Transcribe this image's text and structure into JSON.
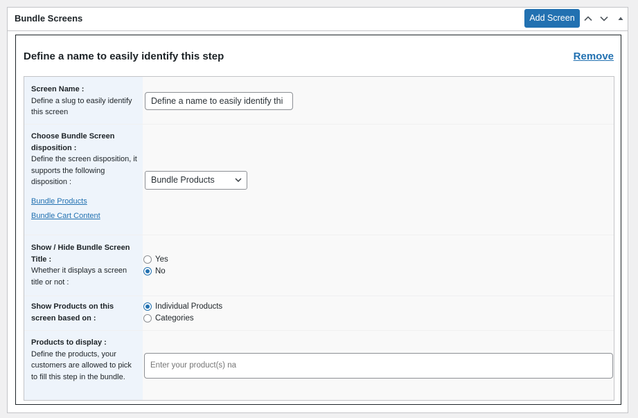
{
  "postbox": {
    "title": "Bundle Screens",
    "add_button": "Add Screen"
  },
  "step": {
    "title": "Define a name to easily identify this step",
    "remove_label": "Remove"
  },
  "fields": {
    "screen_name": {
      "label": "Screen Name :",
      "description": "Define a slug to easily identify this screen",
      "value": "Define a name to easily identify thi"
    },
    "disposition": {
      "label": "Choose Bundle Screen disposition :",
      "description": "Define the screen disposition, it supports the following disposition :",
      "link1": "Bundle Products",
      "link2": "Bundle Cart Content",
      "selected": "Bundle Products"
    },
    "show_title": {
      "label": "Show / Hide Bundle Screen Title :",
      "description": "Whether it displays a screen title or not :",
      "options": [
        "Yes",
        "No"
      ],
      "selected": "No"
    },
    "products_based_on": {
      "label": "Show Products on this screen based on :",
      "options": [
        "Individual Products",
        "Categories"
      ],
      "selected": "Individual Products"
    },
    "products_to_display": {
      "label": "Products to display :",
      "description": "Define the products, your customers are allowed to pick to fill this step in the bundle.",
      "placeholder": "Enter your product(s) na"
    }
  }
}
